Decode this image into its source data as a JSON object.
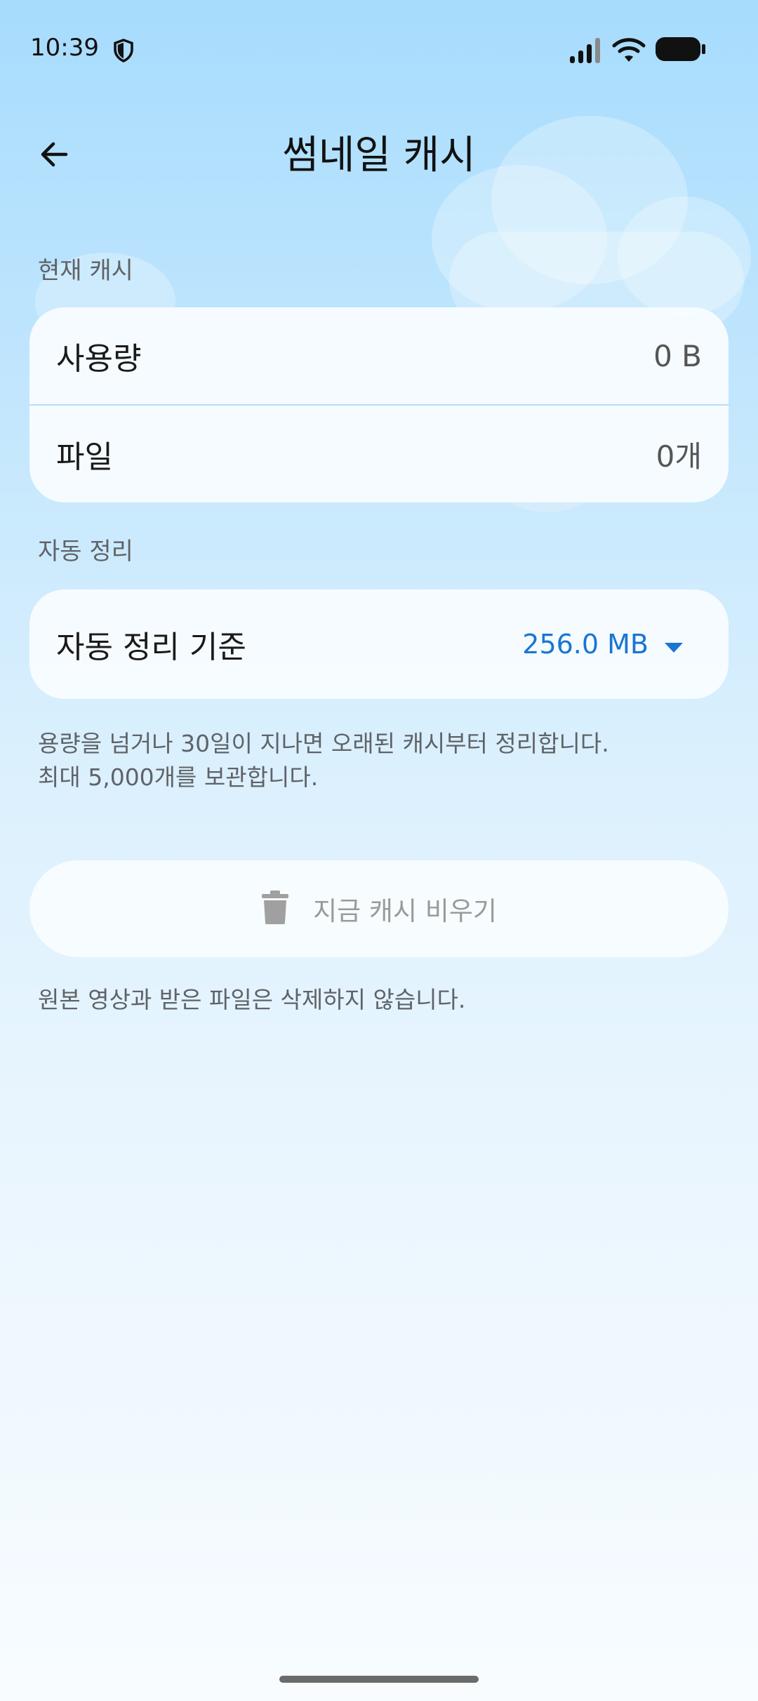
{
  "status_bar": {
    "time": "10:39"
  },
  "header": {
    "title": "썸네일 캐시"
  },
  "current_cache": {
    "section_label": "현재 캐시",
    "usage_label": "사용량",
    "usage_value": "0 B",
    "files_label": "파일",
    "files_value": "0개"
  },
  "auto_cleanup": {
    "section_label": "자동 정리",
    "threshold_label": "자동 정리 기준",
    "threshold_value": "256.0 MB",
    "description_line1": "용량을 넘거나 30일이 지나면 오래된 캐시부터 정리합니다.",
    "description_line2": "최대 5,000개를 보관합니다."
  },
  "clear_action": {
    "button_label": "지금 캐시 비우기",
    "note": "원본 영상과 받은 파일은 삭제하지 않습니다."
  },
  "colors": {
    "accent": "#1976d2",
    "disabled_text": "#9a9a9a",
    "card_background": "#f8fcff"
  },
  "icons": {
    "back": "arrow-left-icon",
    "shield": "shield-icon",
    "signal": "signal-icon",
    "wifi": "wifi-icon",
    "battery": "battery-icon",
    "dropdown": "caret-down-icon",
    "trash": "trash-icon"
  }
}
